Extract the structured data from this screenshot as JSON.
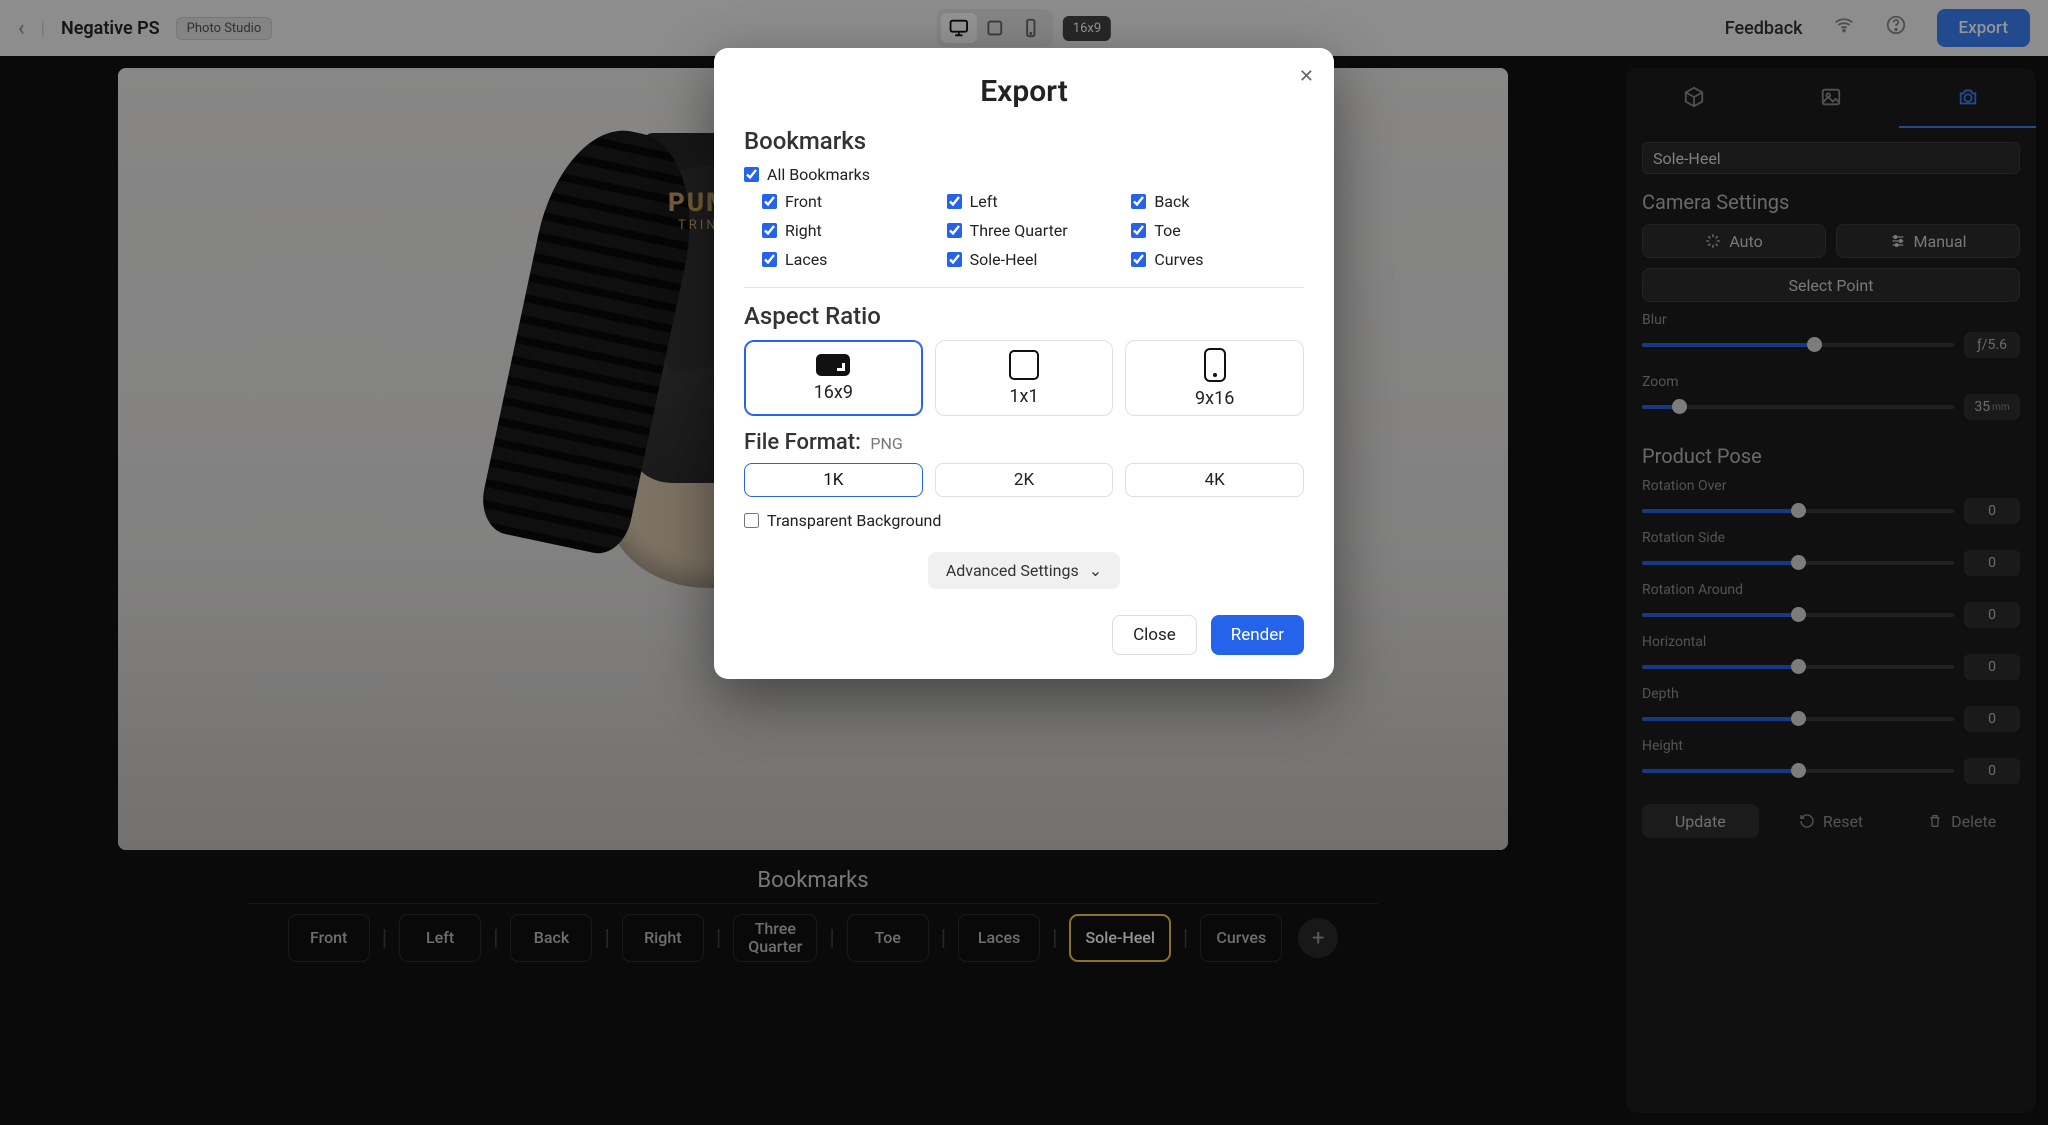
{
  "topbar": {
    "project_name": "Negative PS",
    "tag": "Photo Studio",
    "ratio_badge": "16x9",
    "feedback": "Feedback",
    "export": "Export"
  },
  "viewport": {
    "brand_line1": "PUMA",
    "brand_line2": "TRINOMIC"
  },
  "bookmark_bar": {
    "title": "Bookmarks",
    "items": [
      "Front",
      "Left",
      "Back",
      "Right",
      "Three Quarter",
      "Toe",
      "Laces",
      "Sole-Heel",
      "Curves"
    ],
    "active": "Sole-Heel"
  },
  "panel": {
    "name_value": "Sole-Heel",
    "camera_heading": "Camera Settings",
    "auto": "Auto",
    "manual": "Manual",
    "select_point": "Select Point",
    "blur_label": "Blur",
    "blur_value": "ƒ/5.6",
    "zoom_label": "Zoom",
    "zoom_value": "35",
    "zoom_unit": "mm",
    "pose_heading": "Product Pose",
    "controls": [
      {
        "label": "Rotation Over",
        "value": "0"
      },
      {
        "label": "Rotation Side",
        "value": "0"
      },
      {
        "label": "Rotation Around",
        "value": "0"
      },
      {
        "label": "Horizontal",
        "value": "0"
      },
      {
        "label": "Depth",
        "value": "0"
      },
      {
        "label": "Height",
        "value": "0"
      }
    ],
    "update": "Update",
    "reset": "Reset",
    "delete": "Delete"
  },
  "export_modal": {
    "title": "Export",
    "bookmarks_heading": "Bookmarks",
    "all_label": "All Bookmarks",
    "items": [
      "Front",
      "Left",
      "Back",
      "Right",
      "Three Quarter",
      "Toe",
      "Laces",
      "Sole-Heel",
      "Curves"
    ],
    "aspect_heading": "Aspect Ratio",
    "ratios": [
      "16x9",
      "1x1",
      "9x16"
    ],
    "file_format_label": "File Format:",
    "file_format_value": "PNG",
    "resolutions": [
      "1K",
      "2K",
      "4K"
    ],
    "transparent_label": "Transparent Background",
    "advanced": "Advanced Settings",
    "close": "Close",
    "render": "Render"
  }
}
